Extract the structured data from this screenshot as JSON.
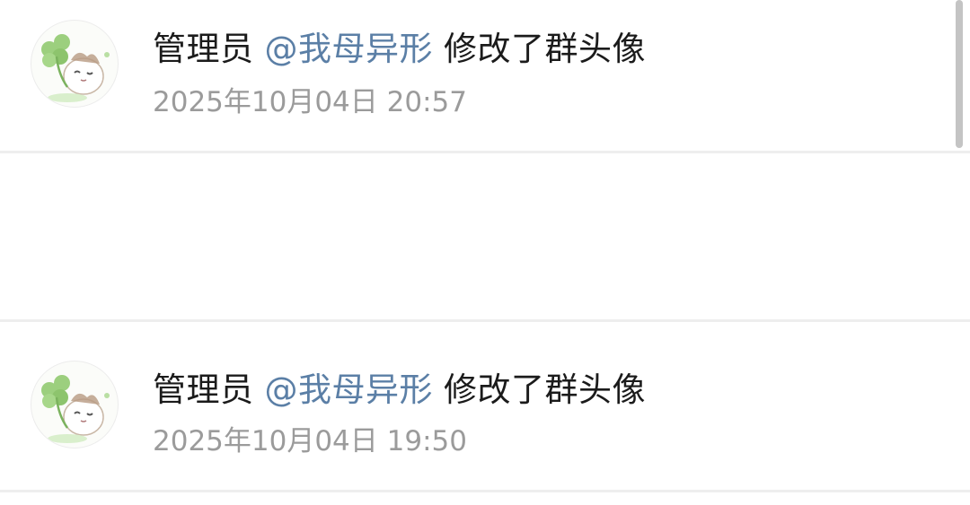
{
  "events": [
    {
      "actor": "管理员",
      "mention": "@我母异形",
      "action": "修改了群头像",
      "timestamp": "2025年10月04日 20:57"
    },
    {
      "actor": "管理员",
      "mention": "@我母异形",
      "action": "修改了群头像",
      "timestamp": "2025年10月04日 19:50"
    }
  ],
  "colors": {
    "mention": "#5b7fa6",
    "primary_text": "#1b1b1b",
    "secondary_text": "#9b9b9b",
    "divider": "#eeeeee"
  },
  "icons": {
    "avatar": "clover-cat-avatar-icon"
  }
}
